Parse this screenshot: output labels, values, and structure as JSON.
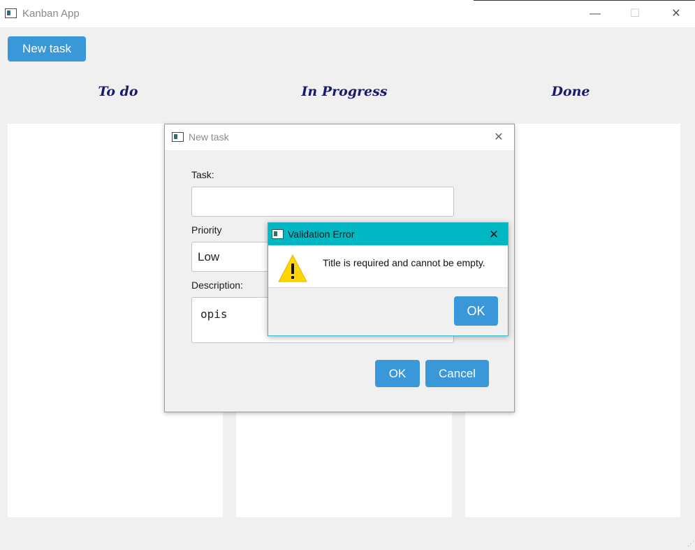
{
  "window": {
    "title": "Kanban App",
    "minimize_glyph": "—",
    "maximize_glyph": "☐",
    "close_glyph": "✕"
  },
  "toolbar": {
    "new_task_label": "New task"
  },
  "columns": [
    {
      "title": "To do"
    },
    {
      "title": "In Progress"
    },
    {
      "title": "Done"
    }
  ],
  "new_task_dialog": {
    "title": "New task",
    "close_glyph": "✕",
    "task_label": "Task:",
    "task_value": "",
    "priority_label": "Priority",
    "priority_value": "Low",
    "description_label": "Description:",
    "description_value": "opis",
    "ok_label": "OK",
    "cancel_label": "Cancel"
  },
  "validation_alert": {
    "title": "Validation Error",
    "close_glyph": "✕",
    "message": "Title is required and cannot be empty.",
    "ok_label": "OK",
    "icon": "warning-icon"
  },
  "colors": {
    "accent": "#3a97d9",
    "alert_titlebar": "#00b7c3",
    "column_title": "#1a1a6a",
    "warning_yellow": "#ffd700"
  }
}
